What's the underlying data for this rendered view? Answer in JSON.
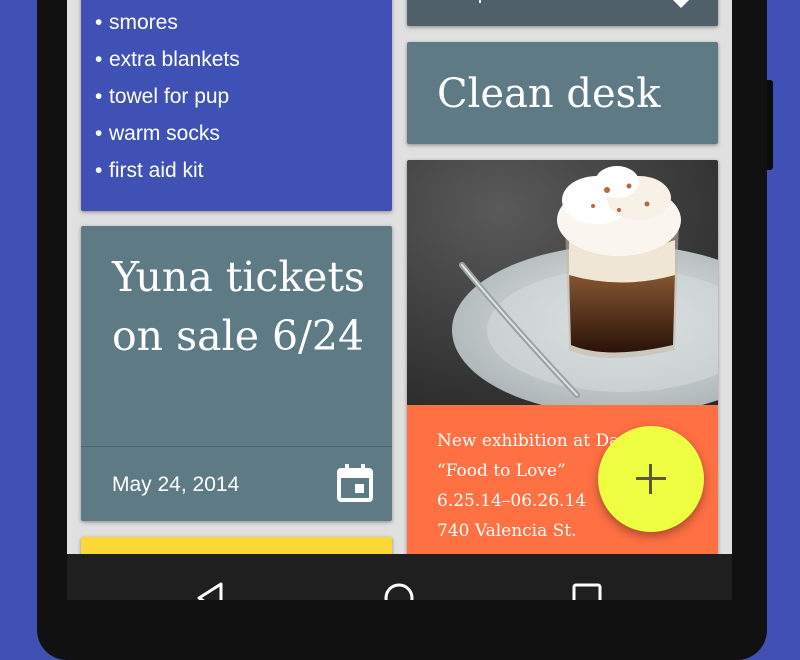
{
  "colors": {
    "background": "#3f51b5",
    "list_card": "#3f51b5",
    "slate_card": "#5d7a85",
    "slate_dark": "#4f6068",
    "orange_card": "#ff7043",
    "yellow_card": "#fdd835",
    "fab": "#eeff41",
    "navbar": "#1f1f1f"
  },
  "list_card": {
    "items": [
      "smores",
      "extra blankets",
      "towel for pup",
      "warm socks",
      "first aid kit"
    ]
  },
  "desk_card": {
    "title": "Clean desk"
  },
  "yuna_card": {
    "title": "Yuna tickets on sale 6/24",
    "date": "May 24, 2014",
    "icon": "calendar-icon"
  },
  "photo_card": {
    "image": "dessert-glass-photo",
    "lines": [
      "New exhibition at Da",
      "“Food to Love”",
      "6.25.14–06.26.14",
      "740 Valencia St."
    ]
  },
  "fab": {
    "icon": "plus-icon"
  },
  "navbar": {
    "icons": [
      "back-icon",
      "home-icon",
      "recent-apps-icon"
    ]
  }
}
